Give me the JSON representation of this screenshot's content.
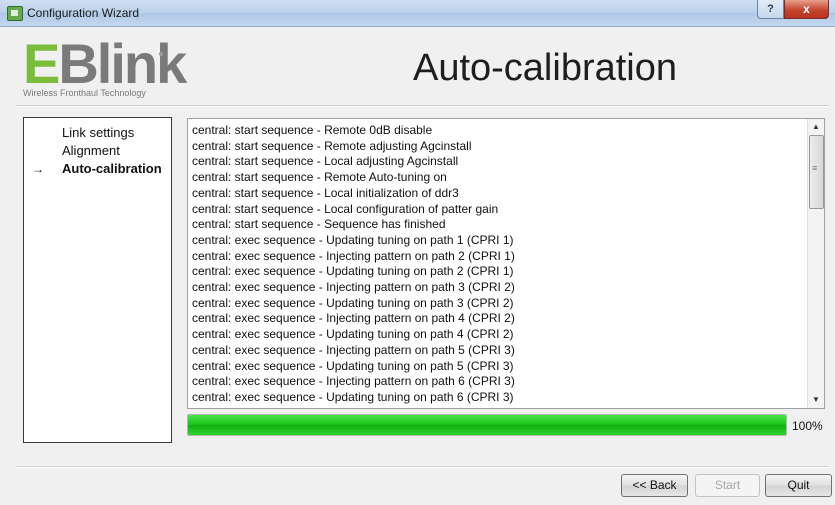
{
  "window": {
    "title": "Configuration Wizard",
    "help_glyph": "?",
    "close_glyph": "x"
  },
  "logo": {
    "mark_e": "E",
    "mark_rest": "Blink",
    "tagline": "Wireless Fronthaul Technology"
  },
  "page_title": "Auto-calibration",
  "nav": {
    "active_marker": "→",
    "items": [
      {
        "label": "Link settings",
        "active": false
      },
      {
        "label": "Alignment",
        "active": false
      },
      {
        "label": "Auto-calibration",
        "active": true
      }
    ]
  },
  "log": {
    "lines": [
      "central: start sequence - Remote 0dB disable",
      "central: start sequence - Remote adjusting Agcinstall",
      "central: start sequence - Local adjusting Agcinstall",
      "central: start sequence - Remote Auto-tuning on",
      "central: start sequence - Local initialization of ddr3",
      "central: start sequence - Local configuration of patter gain",
      "central: start sequence - Sequence has finished",
      "central: exec sequence - Updating tuning on path 1 (CPRI 1)",
      "central: exec sequence - Injecting pattern on path 2 (CPRI 1)",
      "central: exec sequence - Updating tuning on path 2 (CPRI 1)",
      "central: exec sequence - Injecting pattern on path 3 (CPRI 2)",
      "central: exec sequence - Updating tuning on path 3 (CPRI 2)",
      "central: exec sequence - Injecting pattern on path 4 (CPRI 2)",
      "central: exec sequence - Updating tuning on path 4 (CPRI 2)",
      "central: exec sequence - Injecting pattern on path 5 (CPRI 3)",
      "central: exec sequence - Updating tuning on path 5 (CPRI 3)",
      "central: exec sequence - Injecting pattern on path 6 (CPRI 3)",
      "central: exec sequence - Updating tuning on path 6 (CPRI 3)"
    ]
  },
  "progress": {
    "value": 100,
    "label": "100%",
    "color": "#19c219"
  },
  "buttons": {
    "back": "<< Back",
    "start": "Start",
    "quit": "Quit"
  }
}
